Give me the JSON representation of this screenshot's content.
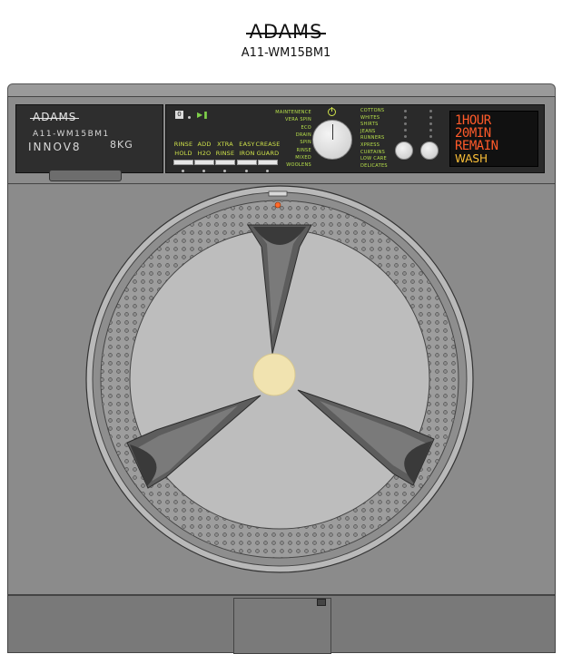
{
  "header": {
    "brand": "ADAMS",
    "model": "A11-WM15BM1"
  },
  "drawer": {
    "brand": "ADAMS",
    "model": "A11-WM15BM1",
    "series": "INNOV8",
    "capacity": "8KG"
  },
  "options": [
    {
      "l1": "RINSE",
      "l2": "HOLD"
    },
    {
      "l1": "ADD",
      "l2": "H2O"
    },
    {
      "l1": "XTRA",
      "l2": "RINSE"
    },
    {
      "l1": "EASY",
      "l2": "IRON"
    },
    {
      "l1": "CREASE",
      "l2": "GUARD"
    }
  ],
  "programs_left": [
    "MAINTENENCE",
    "VERA SPIN",
    "ECO",
    "DRAIN",
    "SPIN",
    "RINSE",
    "MIXED",
    "WOOLENS"
  ],
  "programs_right": [
    "COTTONS",
    "WHITES",
    "SHIRTS",
    "JEANS",
    "RUNNERS",
    "XPRESS",
    "CURTAINS",
    "LOW CARE",
    "DELICATES"
  ],
  "display": {
    "line1": "1HOUR",
    "line2": "20MIN",
    "line3": "REMAIN",
    "mode": "WASH"
  },
  "icons": {
    "start": "start-icon",
    "play_pause": "play-pause-icon",
    "power": "power-icon"
  },
  "colors": {
    "panel_text": "#cfe24a",
    "display_digits": "#ff5a2a",
    "display_mode": "#ffc238",
    "hub": "#f1e3b0",
    "indicator": "#ff6a2a"
  }
}
